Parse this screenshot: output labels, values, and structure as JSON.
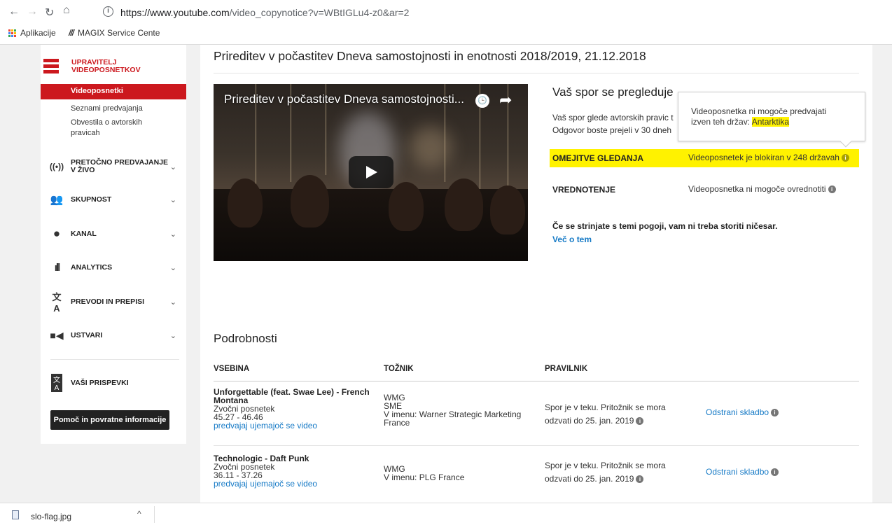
{
  "browser": {
    "url_host": "https://www.youtube.com",
    "url_path": "/video_copynotice?v=WBtIGLu4-z0&ar=2",
    "bookmarks": [
      "Aplikacije",
      "MAGIX Service Cente"
    ]
  },
  "sidebar": {
    "brand_line1": "UPRAVITELJ",
    "brand_line2": "VIDEOPOSNETKOV",
    "active": "Videoposnetki",
    "subitems": [
      "Seznami predvajanja",
      "Obvestila o avtorskih",
      "pravicah"
    ],
    "sections": [
      {
        "label": "PRETOČNO PREDVAJANJE",
        "label2": "V ŽIVO",
        "icon": "live-icon"
      },
      {
        "label": "SKUPNOST",
        "icon": "community-icon"
      },
      {
        "label": "KANAL",
        "icon": "channel-icon"
      },
      {
        "label": "ANALYTICS",
        "icon": "analytics-icon"
      },
      {
        "label": "PREVODI IN PREPISI",
        "icon": "translate-icon"
      },
      {
        "label": "USTVARI",
        "icon": "create-icon"
      }
    ],
    "contributions": "VAŠI PRISPEVKI",
    "help": "Pomoč in povratne informacije"
  },
  "main": {
    "title": "Prireditev v počastitev Dneva samostojnosti in enotnosti 2018/2019, 21.12.2018",
    "video_title": "Prireditev v počastitev Dneva samostojnosti...",
    "status_heading": "Vaš spor se pregleduje",
    "status_line1": "Vaš spor glede avtorskih pravic t",
    "status_line2": "Odgovor boste prejeli v 30 dneh",
    "tooltip_line1": "Videoposnetka ni mogoče predvajati",
    "tooltip_line2": "izven teh držav: ",
    "tooltip_country": "Antarktika",
    "restrict_label": "OMEJITVE GLEDANJA",
    "restrict_value": "Videoposnetek je blokiran v 248 državah",
    "monetize_label": "VREDNOTENJE",
    "monetize_value": "Videoposnetka ni mogoče ovrednotiti",
    "agree_text": "Če se strinjate s temi pogoji, vam ni treba storiti ničesar.",
    "more_link": "Več o tem",
    "details_heading": "Podrobnosti",
    "columns": [
      "VSEBINA",
      "TOŽNIK",
      "PRAVILNIK"
    ],
    "rows": [
      {
        "title1": "Unforgettable (feat. Swae Lee) - French",
        "title2": "Montana",
        "type": "Zvočni posnetek",
        "range": "45.27 - 46.46",
        "play_link": "predvajaj ujemajoč se video",
        "claimant": [
          "WMG",
          "SME",
          "V imenu: Warner Strategic Marketing",
          "France"
        ],
        "policy1": "Spor je v teku. Pritožnik se mora",
        "policy2": "odzvati do 25. jan. 2019",
        "action": "Odstrani skladbo"
      },
      {
        "title1": "Technologic - Daft Punk",
        "type": "Zvočni posnetek",
        "range": "36.11 - 37.26",
        "play_link": "predvajaj ujemajoč se video",
        "claimant": [
          "WMG",
          "V imenu: PLG France"
        ],
        "policy1": "Spor je v teku. Pritožnik se mora",
        "policy2": "odzvati do 25. jan. 2019",
        "action": "Odstrani skladbo"
      }
    ]
  },
  "download": {
    "filename": "slo-flag.jpg"
  },
  "colors": {
    "accent": "#cc181e",
    "highlight": "#fff200",
    "link": "#167ac6"
  }
}
